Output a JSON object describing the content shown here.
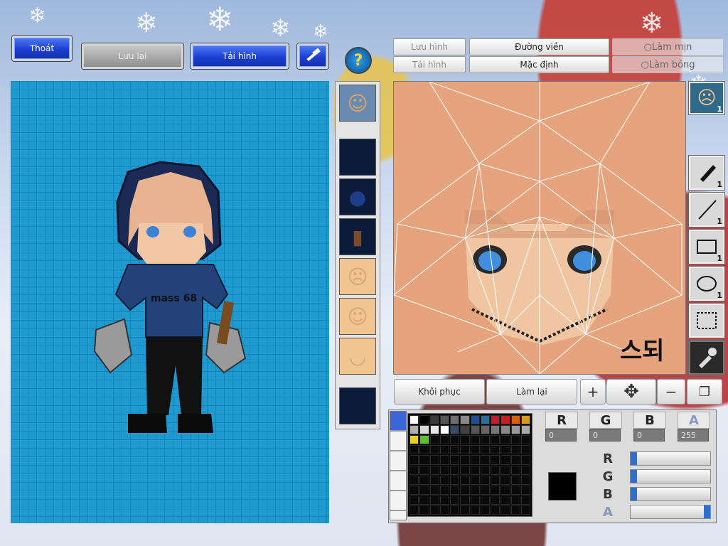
{
  "toolbar_left": {
    "exit_label": "Thoát",
    "save_label": "Lưu lại",
    "load_label": "Tải hình"
  },
  "editor_top": {
    "save_image_label": "Lưu hình",
    "load_image_label": "Tải hình",
    "outline_label": "Đường viền",
    "default_label": "Mặc định",
    "smooth_label": "Làm mịn",
    "shading_label": "Làm bóng"
  },
  "model_shirt_text": "mass 68",
  "tools": [
    {
      "icon": "pen-icon",
      "count": "1"
    },
    {
      "icon": "line-icon",
      "count": "1"
    },
    {
      "icon": "rectangle-icon",
      "count": "1"
    },
    {
      "icon": "ellipse-icon",
      "count": "1"
    },
    {
      "icon": "selection-icon",
      "count": ""
    },
    {
      "icon": "eyedropper-icon",
      "count": ""
    }
  ],
  "face_preview_count": "1",
  "actions": {
    "restore_label": "Khôi phục",
    "redo_label": "Làm lại"
  },
  "color": {
    "r_label": "R",
    "g_label": "G",
    "b_label": "B",
    "a_label": "A",
    "r_value": "0",
    "g_value": "0",
    "b_value": "0",
    "a_value": "255",
    "current_hex": "#000000"
  },
  "palette_colors": [
    "#ffffff",
    "#000000",
    "#3a3a3a",
    "#555555",
    "#6e6e6e",
    "#8a8a8a",
    "#1e4f9c",
    "#2a6c9a",
    "#c0202a",
    "#c62020",
    "#d86010",
    "#d89a20",
    "#b0b0b0",
    "#d8d8d8",
    "#e8e8e8",
    "#ffffff",
    "#3a4a6a",
    "#404040",
    "#555",
    "#666",
    "#777",
    "#888",
    "#999",
    "#aaa",
    "#e8d020",
    "#5cc030"
  ]
}
